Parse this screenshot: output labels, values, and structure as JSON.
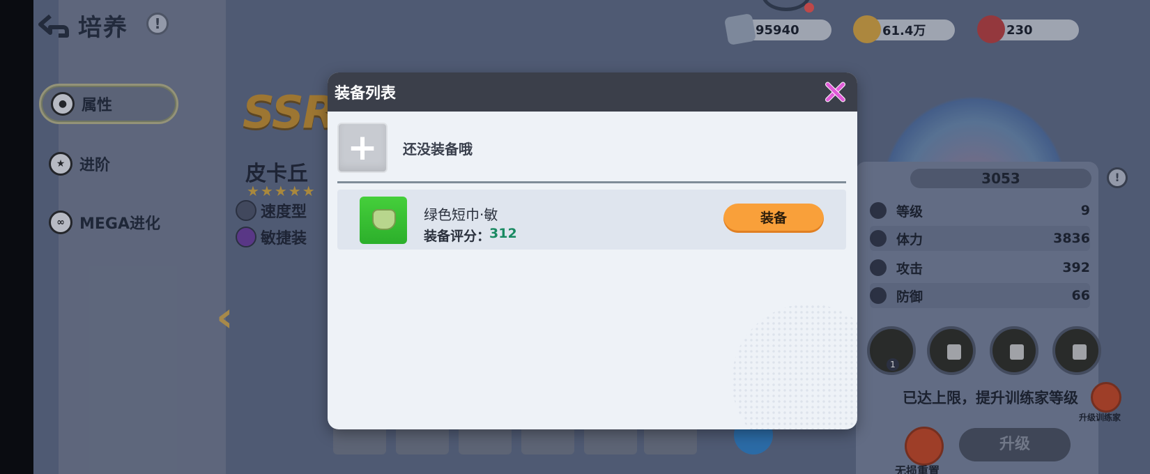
{
  "header": {
    "title": "培养",
    "info": "!"
  },
  "nav": {
    "items": [
      {
        "label": "属性",
        "active": true
      },
      {
        "label": "进阶",
        "active": false
      },
      {
        "label": "MEGA进化",
        "active": false
      }
    ]
  },
  "character": {
    "rarity": "SSR",
    "name": "皮卡丘",
    "stars": "★★★★★",
    "tags": [
      "速度型",
      "敏捷装"
    ]
  },
  "currency": {
    "items": [
      {
        "value": "95940"
      },
      {
        "value": "61.4万"
      },
      {
        "value": "230"
      }
    ]
  },
  "stats": {
    "power": "3053",
    "rows": [
      {
        "label": "等级",
        "value": "9"
      },
      {
        "label": "体力",
        "value": "3836"
      },
      {
        "label": "攻击",
        "value": "392"
      },
      {
        "label": "防御",
        "value": "66"
      }
    ],
    "skill_level_badge": "1",
    "limit_text": "已达上限，提升训练家等级",
    "upgrade_trainer_label": "升级训练家",
    "reset_label": "无损重置",
    "level_up_label": "升级"
  },
  "modal": {
    "title": "装备列表",
    "empty_text": "还没装备哦",
    "item": {
      "name": "绿色短巾·敏",
      "score_label": "装备评分：",
      "score": "312",
      "equip_label": "装备"
    }
  }
}
